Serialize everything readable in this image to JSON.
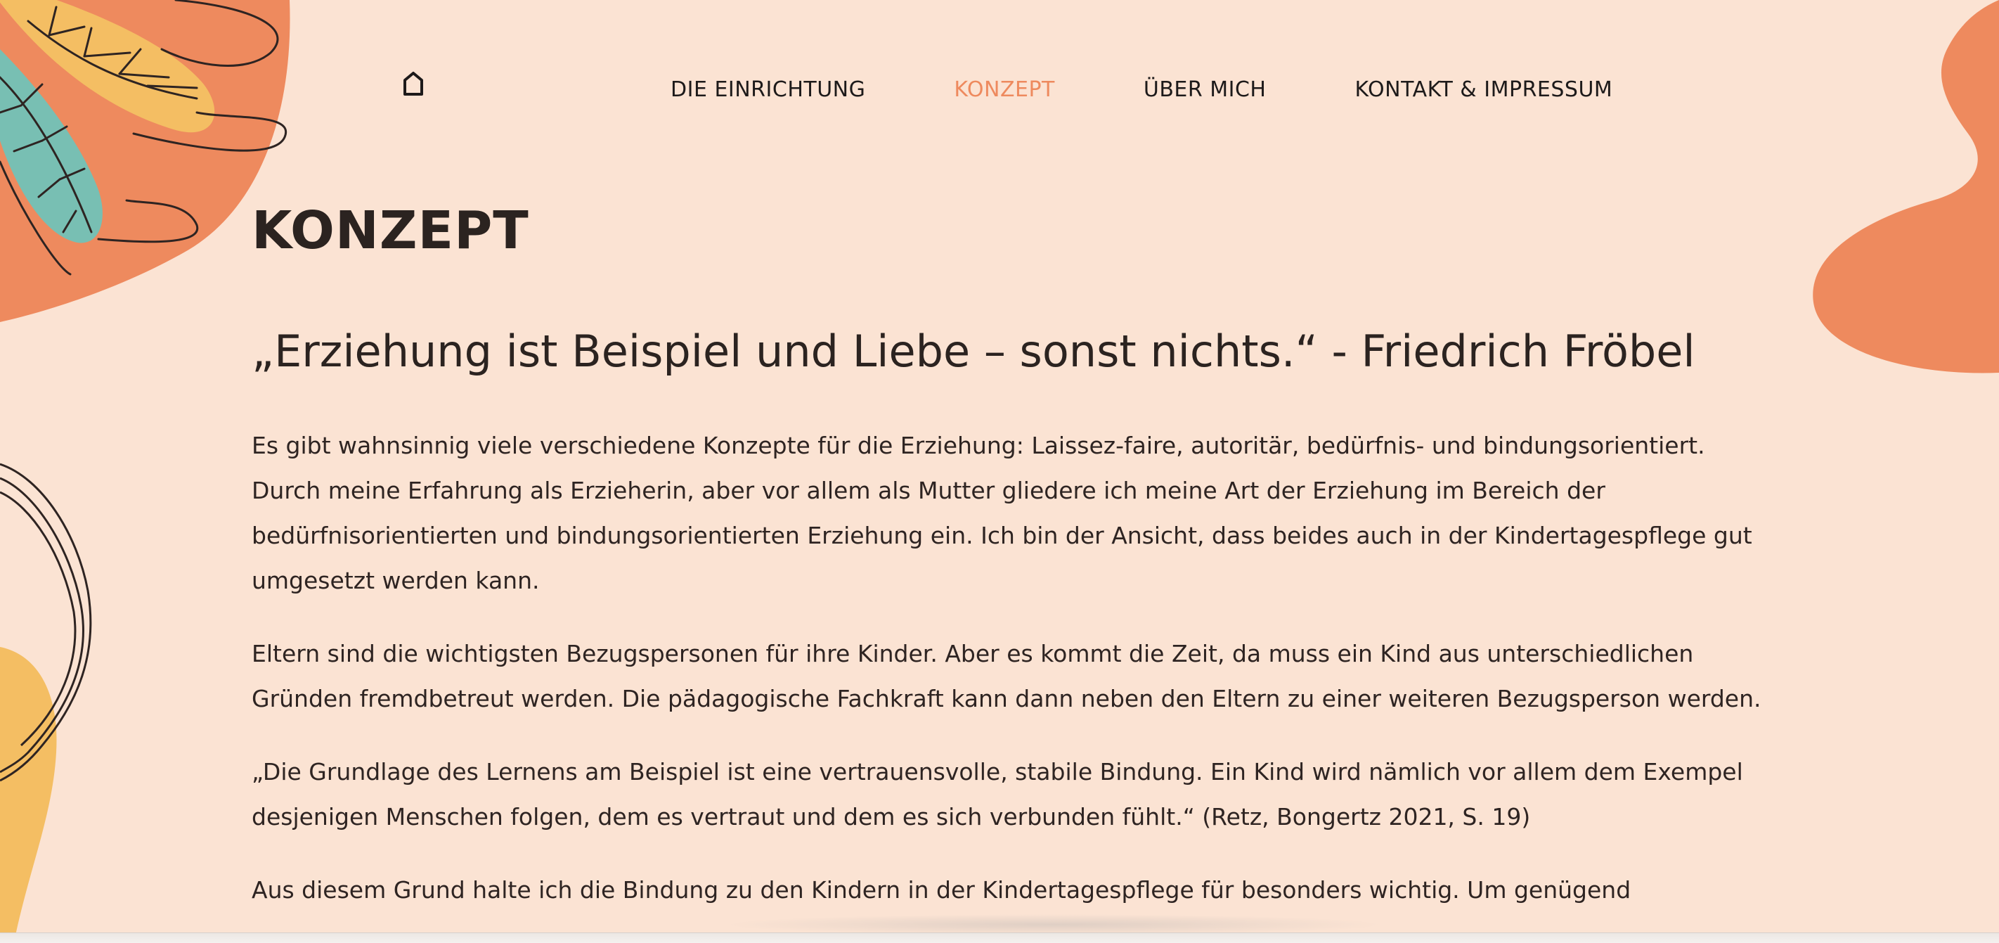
{
  "nav": {
    "home_icon": "home-icon",
    "items": [
      {
        "label": "DIE EINRICHTUNG",
        "active": false
      },
      {
        "label": "KONZEPT",
        "active": true
      },
      {
        "label": "ÜBER MICH",
        "active": false
      },
      {
        "label": "KONTAKT & IMPRESSUM",
        "active": false
      }
    ]
  },
  "page": {
    "title": "KONZEPT",
    "quote": "„Erziehung ist Beispiel und Liebe – sonst nichts.“ - Friedrich Fröbel",
    "paragraphs": [
      "Es gibt wahnsinnig viele verschiedene Konzepte für die Erziehung: Laissez-faire, autoritär, bedürfnis- und bindungsorientiert. Durch meine Erfahrung als Erzieherin, aber vor allem als Mutter gliedere ich meine Art der Erziehung im Bereich der bedürfnisorientierten und bindungsorientierten Erziehung ein. Ich bin der Ansicht, dass beides auch in der Kindertagespflege gut umgesetzt werden kann.",
      "Eltern sind die wichtigsten Bezugspersonen für ihre Kinder. Aber es kommt die Zeit, da muss ein Kind aus unterschiedlichen Gründen fremdbetreut werden. Die pädagogische Fachkraft kann dann neben den Eltern zu einer weiteren Bezugsperson werden.",
      "„Die Grundlage des Lernens am Beispiel ist eine vertrauensvolle, stabile Bindung. Ein Kind wird nämlich vor allem dem Exempel desjenigen Menschen folgen, dem es vertraut und dem es sich verbunden fühlt.“ (Retz, Bongertz 2021, S. 19)",
      "Aus diesem Grund halte ich die Bindung zu den Kindern in der Kindertagespflege für besonders wichtig. Um genügend"
    ]
  },
  "colors": {
    "background": "#fbe3d3",
    "accent_orange": "#ee8a5e",
    "leaf_yellow": "#f4be63",
    "leaf_teal": "#78bfb3",
    "text": "#2e2422"
  }
}
